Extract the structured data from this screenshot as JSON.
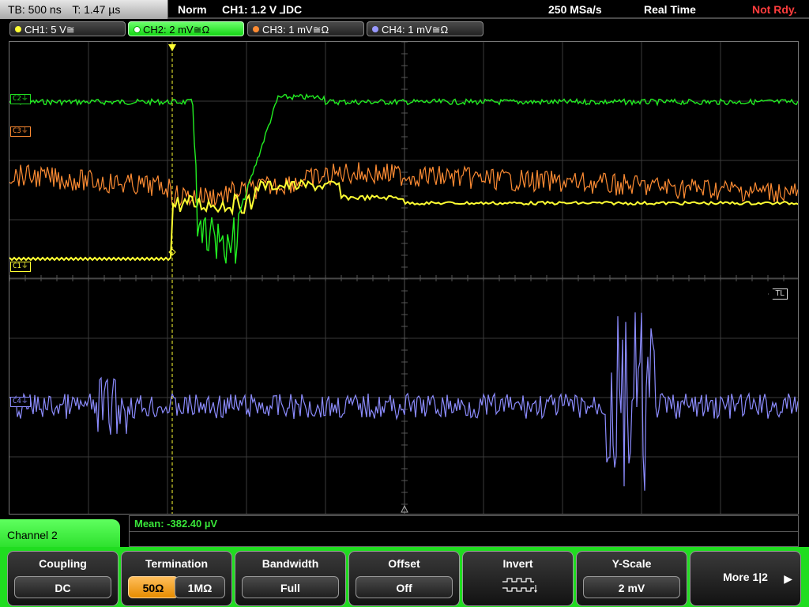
{
  "topbar": {
    "tb": "TB: 500 ns",
    "t": "T: 1.47 µs",
    "mode": "Norm",
    "trigger": "CH1: 1.2 V ⅃DC",
    "sample_rate": "250 MSa/s",
    "acq_mode": "Real Time",
    "ready": "Not Rdy."
  },
  "channels": [
    {
      "label": "CH1: 5 V≅",
      "color": "#ffff33"
    },
    {
      "label": "CH2: 2 mV≅Ω",
      "color": "#22dd22"
    },
    {
      "label": "CH3: 1 mV≅Ω",
      "color": "#ff8c33"
    },
    {
      "label": "CH4: 1 mV≅Ω",
      "color": "#8888ff"
    }
  ],
  "markers": {
    "c1": "C1⏚",
    "c2": "C2⏚",
    "c3": "C3⏚",
    "c4": "C4⏚",
    "tl": "TL",
    "trigger": "T"
  },
  "measurement": {
    "mean": "Mean: -382.40 µV"
  },
  "menu": {
    "title": "Channel 2"
  },
  "softkeys": {
    "coupling": {
      "label": "Coupling",
      "value": "DC"
    },
    "termination": {
      "label": "Termination",
      "value_50": "50Ω",
      "value_1m": "1MΩ"
    },
    "bandwidth": {
      "label": "Bandwidth",
      "value": "Full"
    },
    "offset": {
      "label": "Offset",
      "value": "Off"
    },
    "invert": {
      "label": "Invert"
    },
    "yscale": {
      "label": "Y-Scale",
      "value": "2 mV"
    },
    "more": {
      "label": "More 1|2"
    }
  },
  "icons": {
    "more": "right-arrow-icon",
    "invert": "invert-waveform-icon"
  }
}
